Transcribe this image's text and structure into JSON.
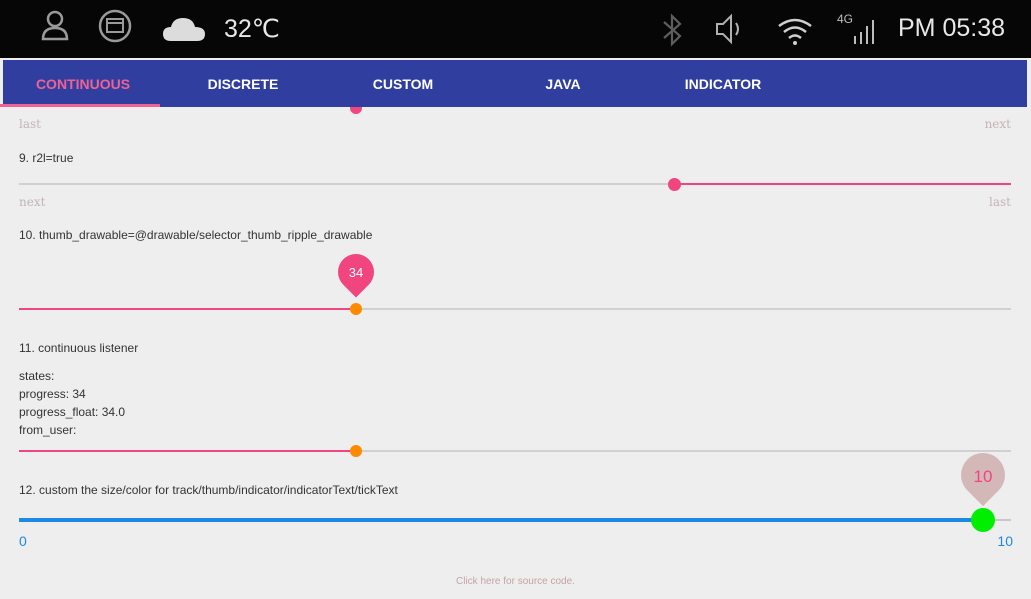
{
  "status_bar": {
    "temperature": "32℃",
    "network": "4G",
    "time": "PM 05:38"
  },
  "tabs": [
    {
      "label": "CONTINUOUS",
      "active": true
    },
    {
      "label": "DISCRETE",
      "active": false
    },
    {
      "label": "CUSTOM",
      "active": false
    },
    {
      "label": "JAVA",
      "active": false
    },
    {
      "label": "INDICATOR",
      "active": false
    }
  ],
  "seekbar_8": {
    "tick_left": "last",
    "tick_right": "next"
  },
  "seekbar_9": {
    "title": "9. r2l=true",
    "tick_left": "next",
    "tick_right": "last",
    "progress_fraction": 0.34
  },
  "seekbar_10": {
    "title": "10. thumb_drawable=@drawable/selector_thumb_ripple_drawable",
    "indicator_value": "34",
    "progress_fraction": 0.34
  },
  "seekbar_11": {
    "title": "11. continuous listener",
    "states_label": "states:",
    "progress_label": "progress: 34",
    "progress_float_label": "progress_float: 34.0",
    "from_user_label": "from_user:",
    "progress_fraction": 0.34
  },
  "seekbar_12": {
    "title": "12. custom the size/color for track/thumb/indicator/indicatorText/tickText",
    "indicator_value": "10",
    "tick_min": "0",
    "tick_max": "10",
    "progress_fraction": 1.0
  },
  "footer": {
    "source_link": "Click here for source code."
  },
  "colors": {
    "tab_bar": "#303f9f",
    "accent_pink": "#f0457e",
    "thumb_orange": "#ff8a00",
    "track_blue": "#1e88e5",
    "thumb_green": "#00ee00"
  }
}
